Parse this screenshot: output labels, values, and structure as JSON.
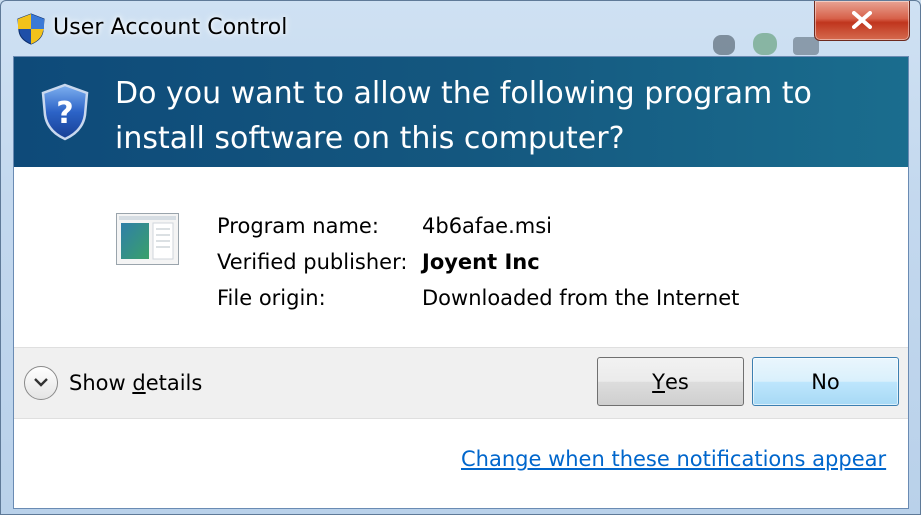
{
  "window": {
    "title": "User Account Control",
    "close_icon": "close-icon"
  },
  "header": {
    "question": "Do you want to allow the following program to install software on this computer?",
    "icon": "uac-shield-icon"
  },
  "details": {
    "program_label": "Program name:",
    "program_value": "4b6afae.msi",
    "publisher_label": "Verified publisher:",
    "publisher_value": "Joyent Inc",
    "origin_label": "File origin:",
    "origin_value": "Downloaded from the Internet"
  },
  "footer": {
    "show_details_prefix": "Show ",
    "show_details_accel": "d",
    "show_details_suffix": "etails",
    "yes_accel": "Y",
    "yes_rest": "es",
    "no_label": "No",
    "change_link": "Change when these notifications appear"
  },
  "colors": {
    "header_bg": "#0e4a79",
    "link": "#0066cc",
    "close_red": "#c0351d"
  }
}
